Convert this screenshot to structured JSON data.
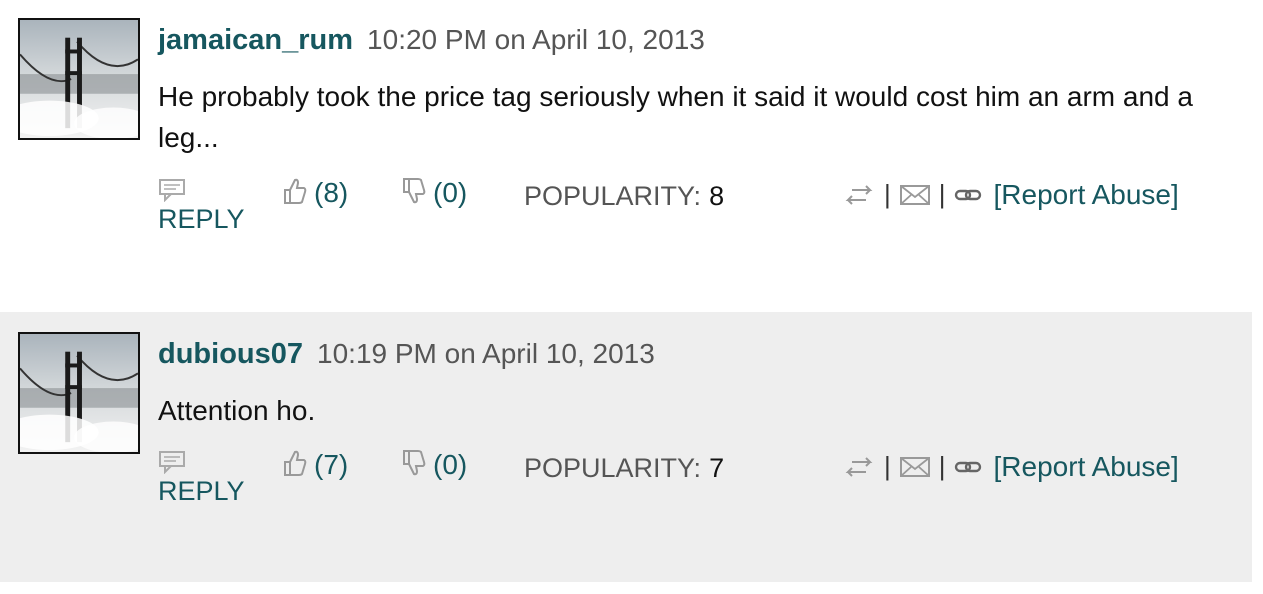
{
  "comments": [
    {
      "username": "jamaican_rum",
      "timestamp": "10:20 PM on April 10, 2013",
      "text": "He probably took the price tag seriously when it said it would cost him an arm and a leg...",
      "reply_label": "REPLY",
      "likes": "(8)",
      "dislikes": "(0)",
      "popularity_label": "POPULARITY:",
      "popularity_value": "8",
      "report_label": "[Report Abuse]"
    },
    {
      "username": "dubious07",
      "timestamp": "10:19 PM on April 10, 2013",
      "text": "Attention ho.",
      "reply_label": "REPLY",
      "likes": "(7)",
      "dislikes": "(0)",
      "popularity_label": "POPULARITY:",
      "popularity_value": "7",
      "report_label": "[Report Abuse]"
    }
  ],
  "icons": {
    "reply": "speech-bubble-icon",
    "like": "thumbs-up-icon",
    "dislike": "thumbs-down-icon",
    "share": "share-arrows-icon",
    "email": "envelope-icon",
    "link": "chain-link-icon"
  },
  "colors": {
    "accent": "#16575f",
    "muted": "#555555",
    "alt_row_bg": "#eeeeee"
  }
}
